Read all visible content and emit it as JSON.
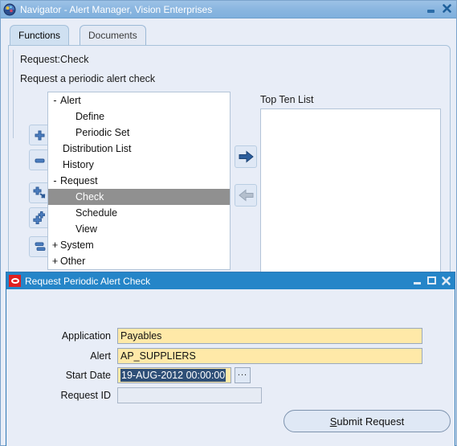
{
  "navigator": {
    "title": "Navigator - Alert Manager, Vision Enterprises",
    "icon": "oracle-globe-icon",
    "window_buttons": {
      "minimize": "minimize-icon",
      "close": "close-icon"
    },
    "tabs": [
      {
        "label": "Functions",
        "active": true
      },
      {
        "label": "Documents",
        "active": false
      }
    ],
    "request_heading": "Request:Check",
    "request_description": "Request a periodic alert check",
    "tree": {
      "items": [
        {
          "toggle": "-",
          "label": "Alert",
          "indent": 0,
          "selected": false
        },
        {
          "toggle": "",
          "label": "Define",
          "indent": 1,
          "selected": false
        },
        {
          "toggle": "",
          "label": "Periodic Set",
          "indent": 1,
          "selected": false
        },
        {
          "toggle": "",
          "label": "Distribution List",
          "indent": 0,
          "selected": false
        },
        {
          "toggle": "",
          "label": "History",
          "indent": 0,
          "selected": false
        },
        {
          "toggle": "-",
          "label": "Request",
          "indent": 0,
          "selected": false
        },
        {
          "toggle": "",
          "label": "Check",
          "indent": 1,
          "selected": true
        },
        {
          "toggle": "",
          "label": "Schedule",
          "indent": 1,
          "selected": false
        },
        {
          "toggle": "",
          "label": "View",
          "indent": 1,
          "selected": false
        },
        {
          "toggle": "+",
          "label": "System",
          "indent": 0,
          "selected": false
        },
        {
          "toggle": "+",
          "label": "Other",
          "indent": 0,
          "selected": false
        }
      ]
    },
    "tree_toolbar": [
      {
        "icon": "expand-plus-icon"
      },
      {
        "icon": "collapse-minus-icon"
      },
      {
        "icon": "expand-branch-icon"
      },
      {
        "icon": "expand-all-icon"
      },
      {
        "icon": "collapse-all-icon"
      }
    ],
    "transfer_buttons": [
      {
        "icon": "arrow-right-icon",
        "enabled": true
      },
      {
        "icon": "arrow-left-icon",
        "enabled": false
      }
    ],
    "top_ten_list": {
      "label": "Top Ten List",
      "items": []
    }
  },
  "dialog": {
    "title": "Request Periodic Alert Check",
    "icon": "oracle-logo-icon",
    "window_buttons": {
      "minimize": "minimize-icon",
      "maximize": "maximize-icon",
      "close": "close-icon"
    },
    "fields": [
      {
        "label": "Application",
        "value": "Payables",
        "state": "normal"
      },
      {
        "label": "Alert",
        "value": "AP_SUPPLIERS",
        "state": "normal"
      },
      {
        "label": "Start Date",
        "value": "19-AUG-2012 00:00:00",
        "state": "selected"
      },
      {
        "label": "Request ID",
        "value": "",
        "state": "disabled"
      }
    ],
    "lov_button": {
      "label": "...",
      "name": "list-of-values-button"
    },
    "submit_button": {
      "accel": "S",
      "rest": "ubmit Request"
    }
  },
  "colors": {
    "nav_titlebar": "#8ab6e0",
    "dialog_titlebar": "#2585c8",
    "panel_bg": "#e8edf7",
    "field_bg": "#ffe9a8",
    "selection_bg": "#2e4f77",
    "tree_selection_bg": "#909090",
    "accent_arrow": "#2b5d9b"
  }
}
